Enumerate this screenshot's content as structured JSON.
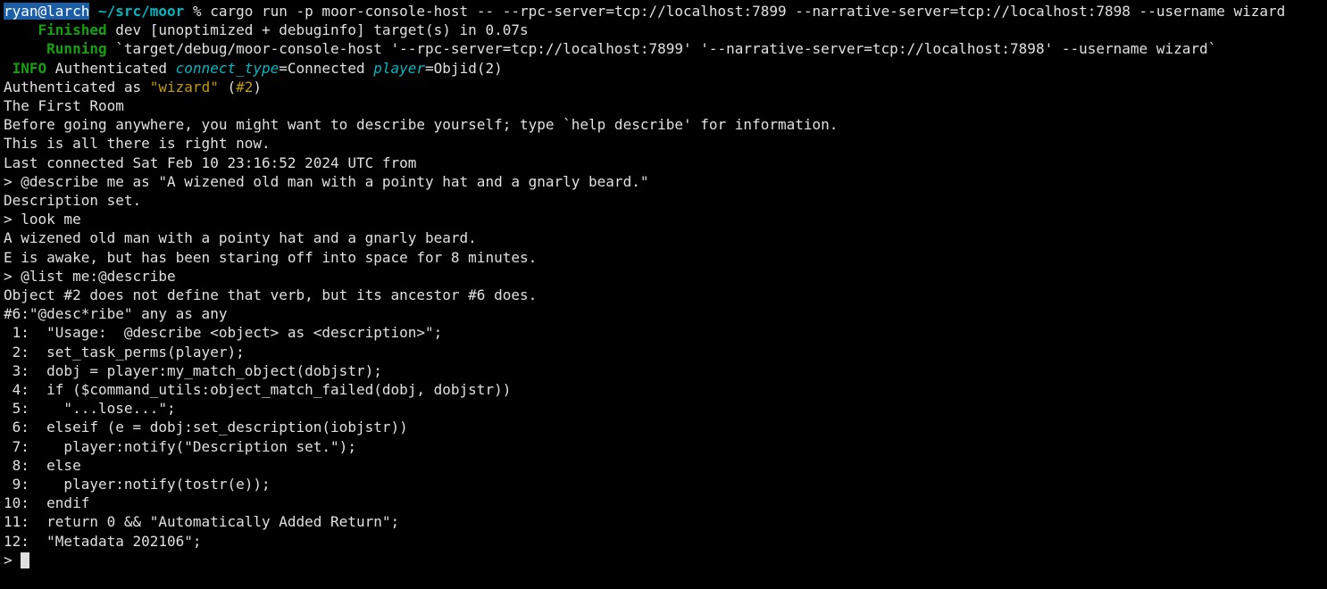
{
  "prompt": {
    "user_host": "ryan@larch",
    "sep": " ",
    "path": "~/src/moor",
    "sigil": " % ",
    "command": "cargo run -p moor-console-host -- --rpc-server=tcp://localhost:7899 --narrative-server=tcp://localhost:7898 --username wizard"
  },
  "cargo": {
    "finished_label": "    Finished",
    "finished_rest": " dev [unoptimized + debuginfo] target(s) in 0.07s",
    "running_label": "     Running",
    "running_rest": " `target/debug/moor-console-host '--rpc-server=tcp://localhost:7899' '--narrative-server=tcp://localhost:7898' --username wizard`"
  },
  "info": {
    "level": " INFO",
    "msg1": " Authenticated ",
    "kv1_key": "connect_type",
    "kv1_eq": "=Connected ",
    "kv2_key": "player",
    "kv2_eq": "=Objid(2)"
  },
  "auth_line": {
    "prefix": "Authenticated as ",
    "name": "\"wizard\"",
    "mid": " (",
    "objid": "#2",
    "end": ")"
  },
  "session": [
    "The First Room",
    "Before going anywhere, you might want to describe yourself; type `help describe' for information.",
    "This is all there is right now.",
    "Last connected Sat Feb 10 23:16:52 2024 UTC from",
    "> @describe me as \"A wizened old man with a pointy hat and a gnarly beard.\"",
    "Description set.",
    "> look me",
    "A wizened old man with a pointy hat and a gnarly beard.",
    "E is awake, but has been staring off into space for 8 minutes.",
    "> @list me:@describe",
    "Object #2 does not define that verb, but its ancestor #6 does.",
    "#6:\"@desc*ribe\" any as any",
    " 1:  \"Usage:  @describe <object> as <description>\";",
    " 2:  set_task_perms(player);",
    " 3:  dobj = player:my_match_object(dobjstr);",
    " 4:  if ($command_utils:object_match_failed(dobj, dobjstr))",
    " 5:    \"...lose...\";",
    " 6:  elseif (e = dobj:set_description(iobjstr))",
    " 7:    player:notify(\"Description set.\");",
    " 8:  else",
    " 9:    player:notify(tostr(e));",
    "10:  endif",
    "11:  return 0 && \"Automatically Added Return\";",
    "12:  \"Metadata 202106\";"
  ],
  "final_prompt": "> "
}
